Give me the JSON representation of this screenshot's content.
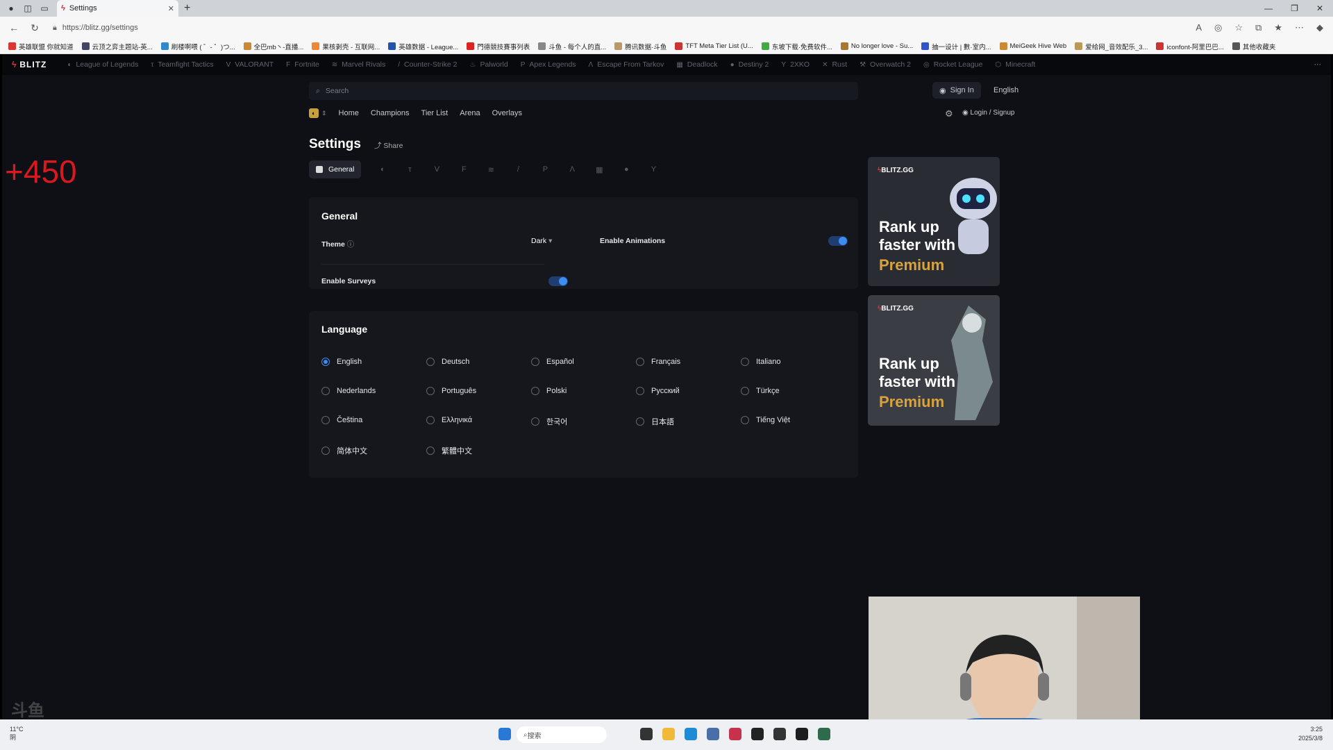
{
  "browser": {
    "tab_title": "Settings",
    "url": "https://blitz.gg/settings",
    "bookmarks": [
      "英雄联盟 你就知道",
      "云顶之弈主题站-英...",
      "刷楼啊喂 ( ゜- ゜)つ...",
      "全巴mb丶-直播...",
      "果核剥壳 - 互联网...",
      "英雄数据 - League...",
      "門德競技賽事列表",
      "斗鱼 - 每个人的直...",
      "腾讯数据·斗鱼",
      "TFT Meta Tier List (U...",
      "东坡下载·免费软件...",
      "No longer love - Su...",
      "抽一设计 | 數·室内...",
      "MeiGeek Hive Web",
      "爱给网_音效配乐_3...",
      "iconfont-阿里巴巴...",
      "其他收藏夹"
    ]
  },
  "app": {
    "logo": "BLITZ",
    "games": [
      "League of Legends",
      "Teamfight Tactics",
      "VALORANT",
      "Fortnite",
      "Marvel Rivals",
      "Counter-Strike 2",
      "Palworld",
      "Apex Legends",
      "Escape From Tarkov",
      "Deadlock",
      "Destiny 2",
      "2XKO",
      "Rust",
      "Overwatch 2",
      "Rocket League",
      "Minecraft"
    ],
    "search_placeholder": "Search",
    "sign_in": "Sign In",
    "language_top": "English",
    "subnav": [
      "Home",
      "Champions",
      "Tier List",
      "Arena",
      "Overlays"
    ],
    "login": "Login / Signup",
    "page_title": "Settings",
    "share": "Share",
    "active_tab": "General"
  },
  "overlay_score": "+450",
  "general": {
    "heading": "General",
    "theme_label": "Theme",
    "theme_value": "Dark",
    "enable_animations": "Enable Animations",
    "enable_surveys": "Enable Surveys",
    "animations_on": true,
    "surveys_on": true
  },
  "language": {
    "heading": "Language",
    "selected": "English",
    "options": [
      "English",
      "Deutsch",
      "Español",
      "Français",
      "Italiano",
      "Nederlands",
      "Português",
      "Polski",
      "Русский",
      "Türkçe",
      "Čeština",
      "Ελληνικά",
      "한국어",
      "日本語",
      "Tiếng Việt",
      "简体中文",
      "繁體中文"
    ]
  },
  "ads": [
    {
      "brand": "BLITZ.GG",
      "line1": "Rank up",
      "line2": "faster with",
      "line3": "Premium"
    },
    {
      "brand": "BLITZ.GG",
      "line1": "Rank up",
      "line2": "faster with",
      "line3": "Premium"
    }
  ],
  "taskbar": {
    "weather": "11°C",
    "weather2": "阴",
    "search": "搜索",
    "time": "3:25",
    "date": "2025/3/8"
  }
}
